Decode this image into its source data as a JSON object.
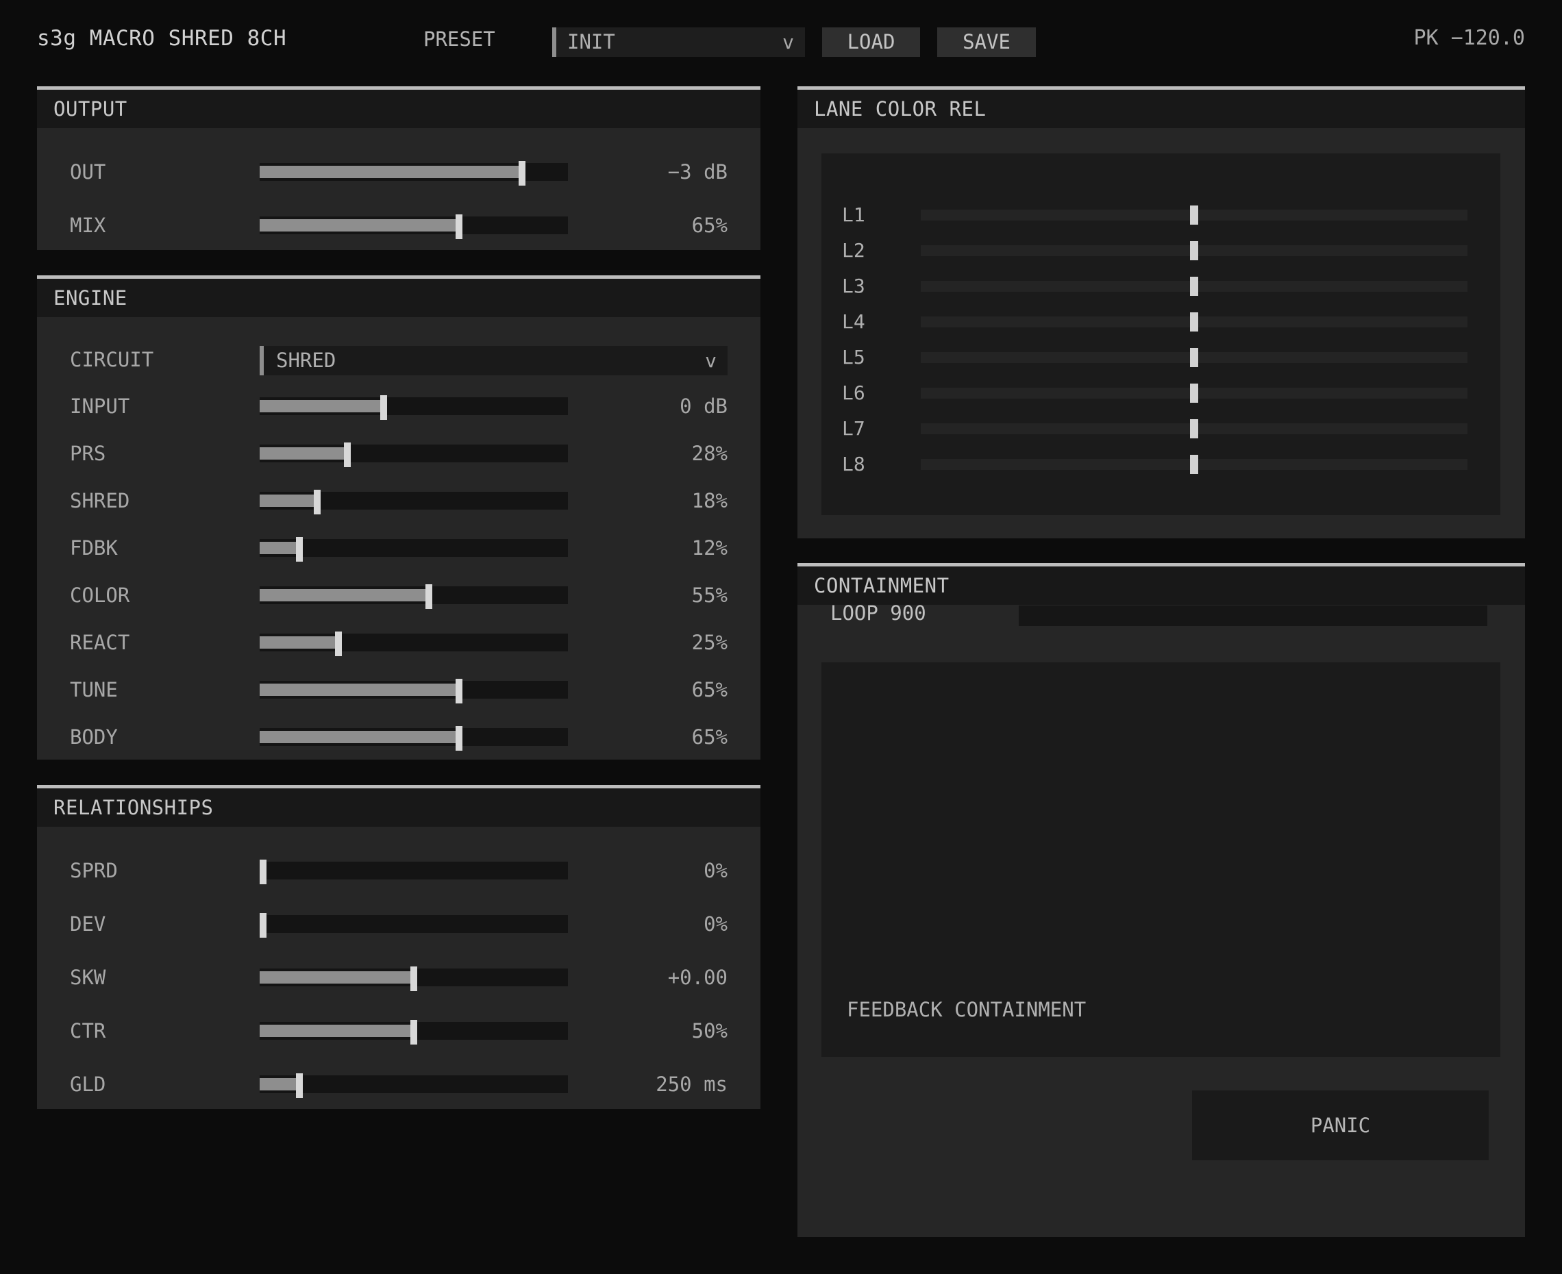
{
  "header": {
    "title": "s3g MACRO SHRED 8CH",
    "preset_label": "PRESET",
    "preset_value": "INIT",
    "chevron": "v",
    "load_label": "LOAD",
    "save_label": "SAVE",
    "peak": "PK −120.0"
  },
  "output": {
    "title": "OUTPUT",
    "rows": [
      {
        "label": "OUT",
        "value": "−3 dB",
        "level": 0.86
      },
      {
        "label": "MIX",
        "value": "65%",
        "level": 0.65
      }
    ]
  },
  "engine": {
    "title": "ENGINE",
    "circuit_label": "CIRCUIT",
    "circuit_value": "SHRED",
    "chevron": "v",
    "rows": [
      {
        "label": "INPUT",
        "value": "0 dB",
        "level": 0.4
      },
      {
        "label": "PRS",
        "value": "28%",
        "level": 0.28
      },
      {
        "label": "SHRED",
        "value": "18%",
        "level": 0.18
      },
      {
        "label": "FDBK",
        "value": "12%",
        "level": 0.12
      },
      {
        "label": "COLOR",
        "value": "55%",
        "level": 0.55
      },
      {
        "label": "REACT",
        "value": "25%",
        "level": 0.25
      },
      {
        "label": "TUNE",
        "value": "65%",
        "level": 0.65
      },
      {
        "label": "BODY",
        "value": "65%",
        "level": 0.65
      }
    ]
  },
  "relationships": {
    "title": "RELATIONSHIPS",
    "rows": [
      {
        "label": "SPRD",
        "value": "0%",
        "level": 0.0
      },
      {
        "label": "DEV",
        "value": "0%",
        "level": 0.0
      },
      {
        "label": "SKW",
        "value": "+0.00",
        "level": 0.5
      },
      {
        "label": "CTR",
        "value": "50%",
        "level": 0.5
      },
      {
        "label": "GLD",
        "value": "250 ms",
        "level": 0.12
      }
    ]
  },
  "lane_color": {
    "title": "LANE COLOR REL",
    "lanes": [
      {
        "label": "L1",
        "level": 0.5
      },
      {
        "label": "L2",
        "level": 0.5
      },
      {
        "label": "L3",
        "level": 0.5
      },
      {
        "label": "L4",
        "level": 0.5
      },
      {
        "label": "L5",
        "level": 0.5
      },
      {
        "label": "L6",
        "level": 0.5
      },
      {
        "label": "L7",
        "level": 0.5
      },
      {
        "label": "L8",
        "level": 0.5
      }
    ]
  },
  "containment": {
    "title": "CONTAINMENT",
    "loop_label": "LOOP 900",
    "loop_level": 0,
    "display_label": "FEEDBACK CONTAINMENT",
    "panic_label": "PANIC"
  },
  "colors": {
    "background": "#0c0c0c",
    "panel": "#262626",
    "panel_header": "#181818",
    "fill": "#8e8e8e",
    "thumb": "#d8d8d8"
  }
}
